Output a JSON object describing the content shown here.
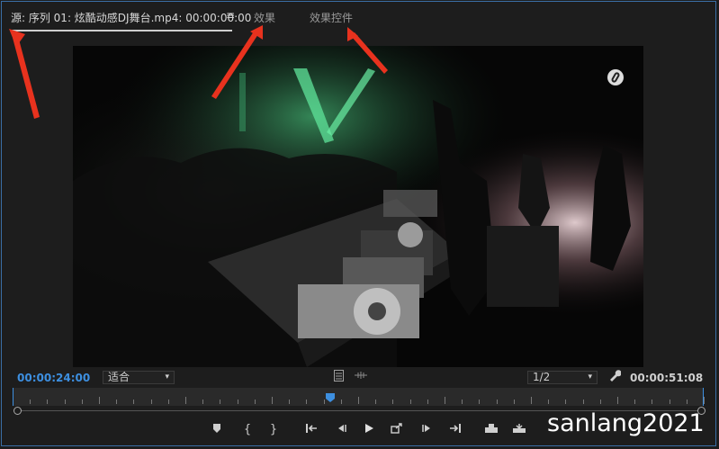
{
  "tabs": {
    "source": "源: 序列 01: 炫酷动感DJ舞台.mp4: 00:00:00:00",
    "menu_icon": "≡",
    "effects": "效果",
    "effect_controls": "效果控件"
  },
  "controls": {
    "current_timecode": "00:00:24:00",
    "fit_label": "适合",
    "resolution_label": "1/2",
    "duration_timecode": "00:00:51:08"
  },
  "playhead_fraction": 0.46,
  "icons": {
    "marker": "marker-icon",
    "in": "mark-in-icon",
    "out": "mark-out-icon",
    "go_in": "go-to-in-icon",
    "step_back": "step-back-icon",
    "play": "play-icon",
    "step_forward": "step-forward-icon",
    "go_out": "go-to-out-icon",
    "insert": "insert-icon",
    "overwrite": "overwrite-icon",
    "export_frame": "export-frame-icon",
    "settings": "wrench-icon"
  },
  "watermark": "sanlang2021",
  "colors": {
    "accent": "#3d8fe0",
    "annotation_arrow": "#e8321e"
  }
}
